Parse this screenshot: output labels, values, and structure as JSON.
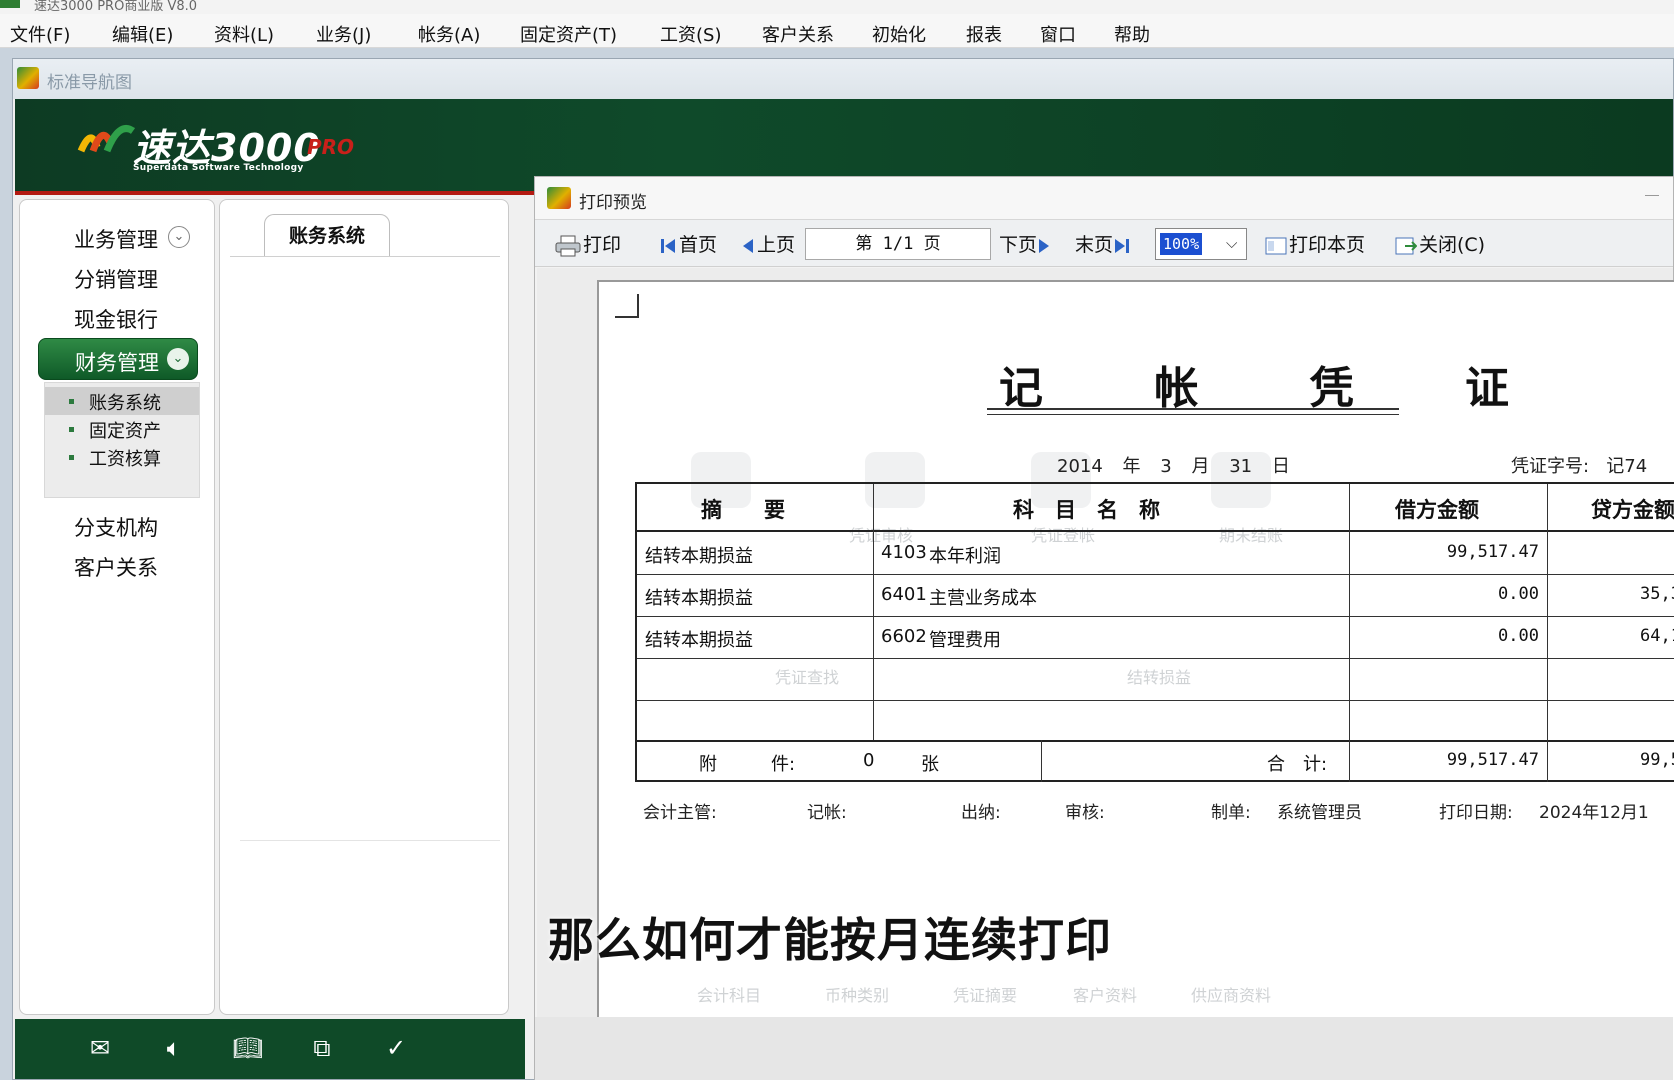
{
  "app": {
    "title": "速达3000 PRO商业版 V8.0"
  },
  "menu": [
    "文件(F)",
    "编辑(E)",
    "资料(L)",
    "业务(J)",
    "帐务(A)",
    "固定资产(T)",
    "工资(S)",
    "客户关系",
    "初始化",
    "报表",
    "窗口",
    "帮助"
  ],
  "nav_window": {
    "title": "标准导航图",
    "logo": {
      "name": "速达3000",
      "suffix": "PRO",
      "tagline": "Superdata Software Technology"
    },
    "left_menu": {
      "items_top": [
        "业务管理",
        "分销管理",
        "现金银行"
      ],
      "active": "财务管理",
      "sub_items": [
        "账务系统",
        "固定资产",
        "工资核算"
      ],
      "selected_sub": "账务系统",
      "items_bottom": [
        "分支机构",
        "客户关系"
      ]
    },
    "center_tab": "账务系统",
    "bottom_icons": [
      "mail-icon",
      "speaker-icon",
      "book-icon",
      "copy-icon",
      "check-icon"
    ],
    "watermark_labels": [
      "凭证审核",
      "凭证登帐",
      "期末结账",
      "凭证查找",
      "结转损益",
      "会计科目",
      "币种类别",
      "凭证摘要",
      "客户资料",
      "供应商资料"
    ]
  },
  "preview": {
    "title": "打印预览",
    "toolbar": {
      "print": "打印",
      "first": "首页",
      "prev": "上页",
      "page_indicator": "第 1/1 页",
      "next": "下页",
      "last": "末页",
      "zoom": "100%",
      "print_page": "打印本页",
      "close": "关闭(C)"
    },
    "voucher": {
      "title": "记 帐 凭 证",
      "date": {
        "year": "2014",
        "year_label": "年",
        "month": "3",
        "month_label": "月",
        "day": "31",
        "day_label": "日"
      },
      "number_label": "凭证字号:",
      "number_value": "记74",
      "headers": [
        "摘　　要",
        "科　目　名　称",
        "借方金额",
        "贷方金额"
      ],
      "rows": [
        {
          "summary": "结转本期损益",
          "account_code": "4103",
          "account_name": "本年利润",
          "debit": "99,517.47",
          "credit": ""
        },
        {
          "summary": "结转本期损益",
          "account_code": "6401",
          "account_name": "主营业务成本",
          "debit": "0.00",
          "credit": "35,3"
        },
        {
          "summary": "结转本期损益",
          "account_code": "6602",
          "account_name": "管理费用",
          "debit": "0.00",
          "credit": "64,1"
        }
      ],
      "footer": {
        "attach_label": "附　　　件:",
        "attach_count": "0",
        "attach_unit": "张",
        "total_label": "合　计:",
        "total_debit": "99,517.47",
        "total_credit": "99,5"
      },
      "signatures": {
        "supervisor": "会计主管:",
        "bookkeeper": "记帐:",
        "cashier": "出纳:",
        "auditor": "审核:",
        "maker_label": "制单:",
        "maker": "系统管理员",
        "print_date_label": "打印日期:",
        "print_date": "2024年12月1"
      }
    }
  },
  "subtitle": "那么如何才能按月连续打印"
}
